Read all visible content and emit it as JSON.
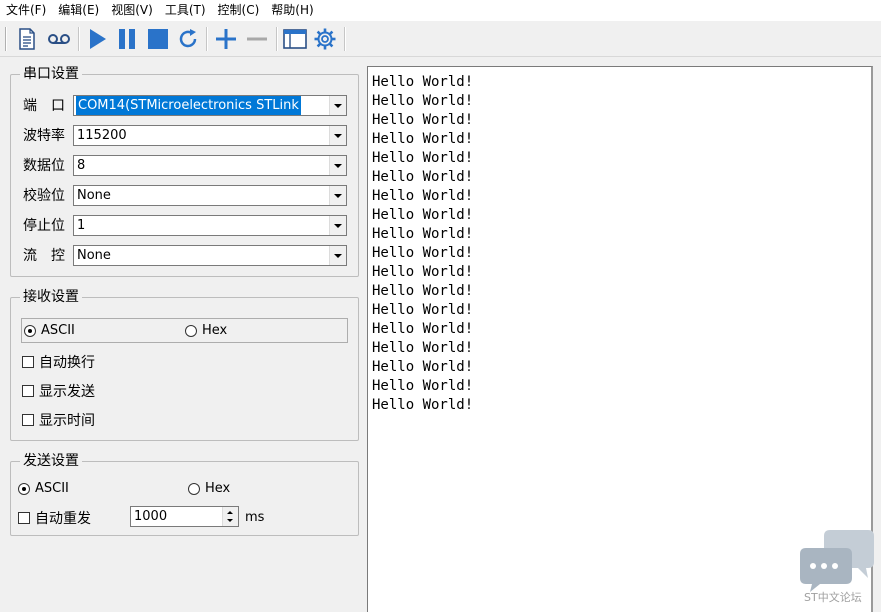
{
  "menu": [
    "文件(F)",
    "编辑(E)",
    "视图(V)",
    "工具(T)",
    "控制(C)",
    "帮助(H)"
  ],
  "toolbar": {
    "icons": [
      "document-icon",
      "record-icon",
      "play-icon",
      "pause-icon",
      "stop-icon",
      "refresh-icon",
      "plus-icon",
      "minus-icon",
      "window-icon",
      "gear-icon"
    ],
    "accent": "#2a73c9"
  },
  "serial": {
    "title": "串口设置",
    "rows": [
      {
        "label": "端　口",
        "value": "COM14(STMicroelectronics STLink"
      },
      {
        "label": "波特率",
        "value": "115200"
      },
      {
        "label": "数据位",
        "value": "8"
      },
      {
        "label": "校验位",
        "value": "None"
      },
      {
        "label": "停止位",
        "value": "1"
      },
      {
        "label": "流　控",
        "value": "None"
      }
    ]
  },
  "receive": {
    "title": "接收设置",
    "ascii": "ASCII",
    "hex": "Hex",
    "selected": "ASCII",
    "checks": [
      "自动换行",
      "显示发送",
      "显示时间"
    ]
  },
  "send": {
    "title": "发送设置",
    "ascii": "ASCII",
    "hex": "Hex",
    "selected": "ASCII",
    "auto_resend": "自动重发",
    "interval": "1000",
    "unit": "ms"
  },
  "output": {
    "lines": [
      "Hello World!",
      "Hello World!",
      "Hello World!",
      "Hello World!",
      "Hello World!",
      "Hello World!",
      "Hello World!",
      "Hello World!",
      "Hello World!",
      "Hello World!",
      "Hello World!",
      "Hello World!",
      "Hello World!",
      "Hello World!",
      "Hello World!",
      "Hello World!",
      "Hello World!",
      "Hello World!"
    ]
  },
  "watermark": {
    "text": "ST中文论坛"
  }
}
